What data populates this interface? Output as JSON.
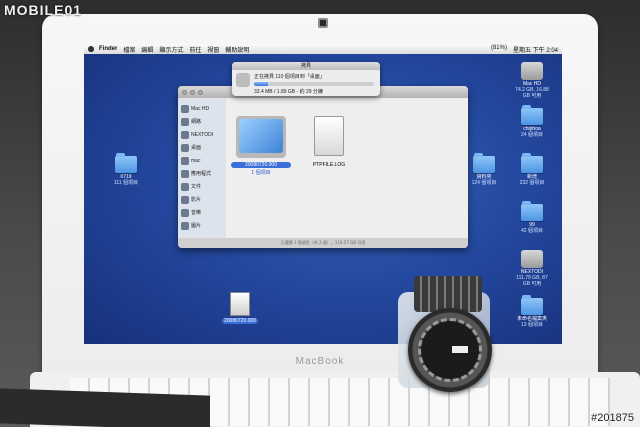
{
  "watermark": {
    "logo": "MOBILE01",
    "photo_id": "#201875"
  },
  "laptop": {
    "brand": "MacBook"
  },
  "menubar": {
    "app": "Finder",
    "items": [
      "檔案",
      "編輯",
      "顯示方式",
      "前往",
      "視窗",
      "輔助說明"
    ],
    "battery": "(81%)",
    "clock": "星期五 下午 2:04"
  },
  "copy_dialog": {
    "title": "拷貝",
    "status": "正在拷貝 110 個項目到「桌面」",
    "detail": "33.4 MB / 1.89 GB - 約 29 分鐘",
    "progress": 0.12
  },
  "finder": {
    "sidebar": [
      "Mac HD",
      "網路",
      "NEXTODI",
      "桌面",
      "mac",
      "應用程式",
      "文件",
      "影片",
      "音樂",
      "圖片"
    ],
    "files": [
      {
        "name": "20080720.000",
        "sub": "1 個項目"
      },
      {
        "name": "PTPFILE.LOG",
        "sub": ""
      }
    ],
    "status": "已選擇 1 個項目（共 2 個），119.57 GB 可用"
  },
  "desktop": {
    "left_icons": [
      {
        "name": "0719",
        "sub": "111 個項目"
      }
    ],
    "selected_file": "20080720.000",
    "right_icons": [
      {
        "name": "Mac HD",
        "sub": "74.2 GB, 16.88 GB 可用"
      },
      {
        "name": "chiphoa",
        "sub": "24 個項目"
      },
      {
        "name": "新增",
        "sub": "232 個項目"
      },
      {
        "name": "資料夾",
        "sub": "124 個項目"
      },
      {
        "name": "99",
        "sub": "42 個項目"
      },
      {
        "name": "NEXTODI",
        "sub": "111.79 GB, 87 GB 可用"
      },
      {
        "name": "未命名檔案夾",
        "sub": "13 個項目"
      }
    ]
  }
}
